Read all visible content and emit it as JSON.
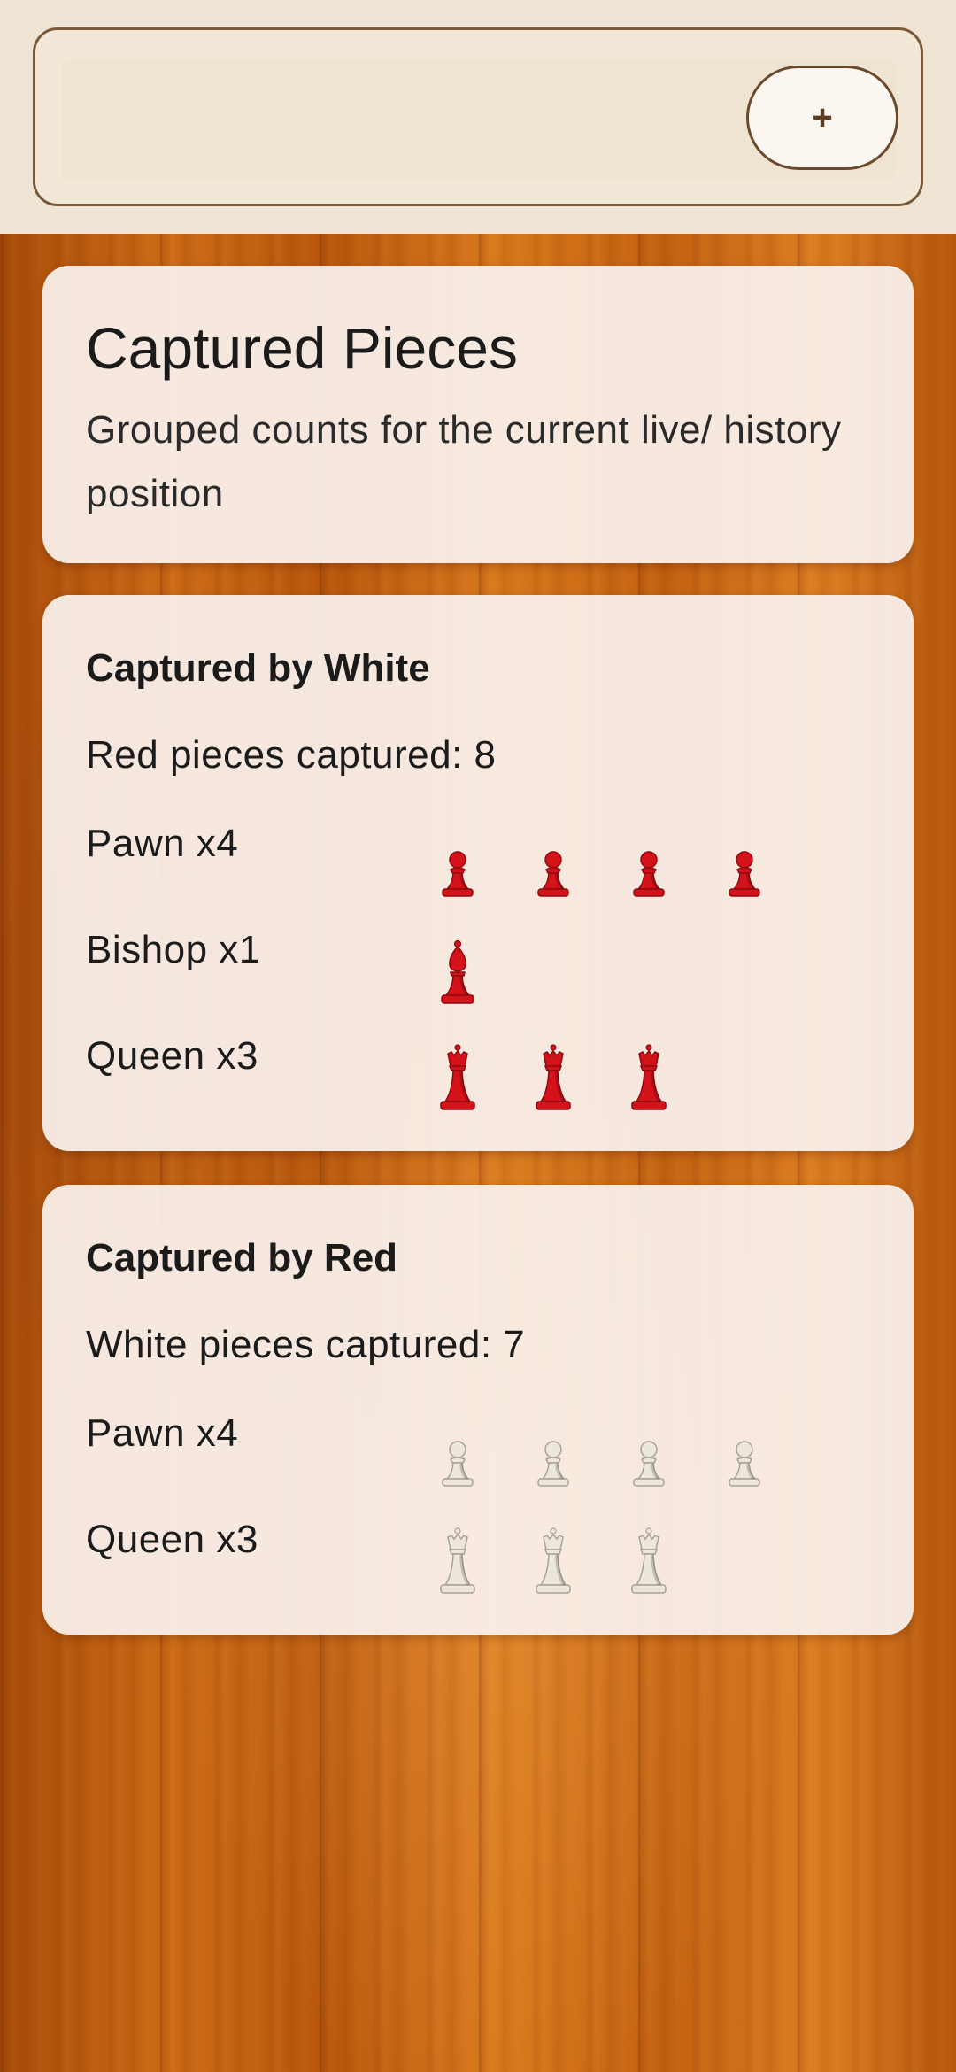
{
  "topbar": {
    "add_label": "+"
  },
  "header": {
    "title": "Captured Pieces",
    "subtitle": "Grouped counts for the current live/ history position"
  },
  "colors": {
    "red_piece": "#d4121a",
    "white_piece": "#ece6dc",
    "card_bg": "#faf2ee",
    "topbar_bg": "#efe4d3"
  },
  "captured_by_white": {
    "title": "Captured by White",
    "summary": "Red pieces captured: 8",
    "rows": [
      {
        "label": "Pawn x4",
        "piece": "pawn-icon",
        "count": 4
      },
      {
        "label": "Bishop x1",
        "piece": "bishop-icon",
        "count": 1
      },
      {
        "label": "Queen x3",
        "piece": "queen-icon",
        "count": 3
      }
    ]
  },
  "captured_by_red": {
    "title": "Captured by Red",
    "summary": "White pieces captured: 7",
    "rows": [
      {
        "label": "Pawn x4",
        "piece": "pawn-icon",
        "count": 4
      },
      {
        "label": "Queen x3",
        "piece": "queen-icon",
        "count": 3
      }
    ]
  }
}
